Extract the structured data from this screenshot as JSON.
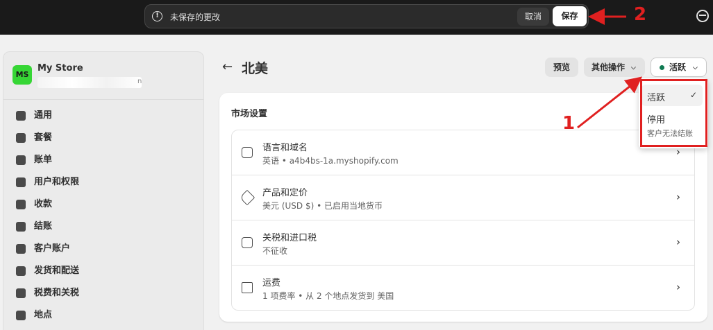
{
  "savebar": {
    "message": "未保存的更改",
    "discard_label": "取消",
    "save_label": "保存",
    "alert_icon": "alert-circle-icon"
  },
  "topbar": {
    "profile_icon": "user-profile-icon"
  },
  "store": {
    "avatar_initials": "MS",
    "name": "My Store",
    "url_tail": "n",
    "avatar_color": "#36d635"
  },
  "sidebar": {
    "items": [
      {
        "label": "通用",
        "icon": "store-icon"
      },
      {
        "label": "套餐",
        "icon": "plan-chart-icon"
      },
      {
        "label": "账单",
        "icon": "billing-dollar-icon"
      },
      {
        "label": "用户和权限",
        "icon": "users-icon"
      },
      {
        "label": "收款",
        "icon": "payments-icon"
      },
      {
        "label": "结账",
        "icon": "cart-icon"
      },
      {
        "label": "客户账户",
        "icon": "customer-icon"
      },
      {
        "label": "发货和配送",
        "icon": "truck-icon"
      },
      {
        "label": "税费和关税",
        "icon": "tax-icon"
      },
      {
        "label": "地点",
        "icon": "location-pin-icon"
      }
    ]
  },
  "header": {
    "title": "北美",
    "preview_label": "预览",
    "more_actions_label": "其他操作",
    "status_label": "活跃",
    "status_color": "#0f7a52"
  },
  "card": {
    "title": "市场设置",
    "rows": [
      {
        "title": "语言和域名",
        "subtitle": "英语 • a4b4bs-1a.myshopify.com",
        "icon": "translate-icon"
      },
      {
        "title": "产品和定价",
        "subtitle": "美元 (USD $) • 已启用当地货币",
        "icon": "price-tag-icon"
      },
      {
        "title": "关税和进口税",
        "subtitle": "不征收",
        "icon": "duties-box-icon"
      },
      {
        "title": "运费",
        "subtitle": "1 项费率 • 从 2 个地点发货到 美国",
        "icon": "shipping-truck-icon"
      }
    ]
  },
  "status_dropdown": {
    "active_label": "活跃",
    "inactive_label": "停用",
    "inactive_note": "客户无法结账"
  },
  "annotations": {
    "step_1": "1",
    "step_2": "2",
    "color": "#e02020"
  }
}
